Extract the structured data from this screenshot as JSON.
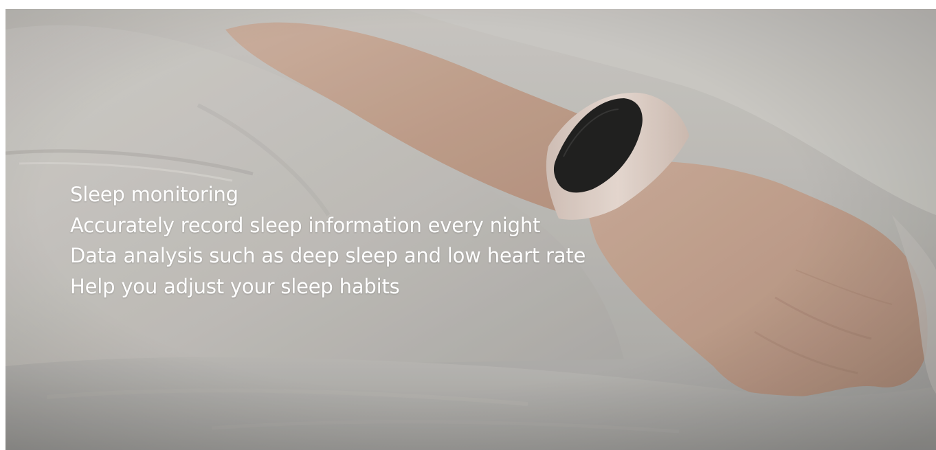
{
  "caption": {
    "lines": [
      "Sleep monitoring",
      "Accurately record sleep information every night",
      "Data analysis such as deep sleep and low heart rate",
      "Help you adjust your sleep habits"
    ]
  },
  "colors": {
    "caption_text": "#ffffff",
    "band_screen": "#111111",
    "band_strap": "#e2cfc6",
    "skin": "#c9a48f",
    "bedding": "#c7c4c0"
  },
  "icons": [
    "fitness-band-icon"
  ]
}
